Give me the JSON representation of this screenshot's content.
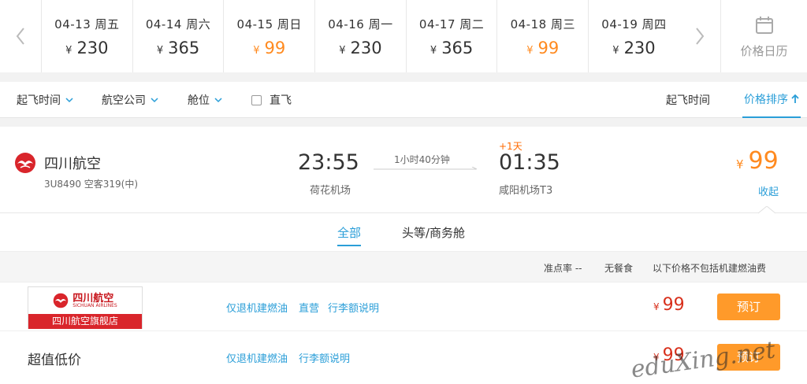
{
  "date_strip": {
    "dates": [
      {
        "date": "04-13 周五",
        "price": "230",
        "low": false
      },
      {
        "date": "04-14 周六",
        "price": "365",
        "low": false
      },
      {
        "date": "04-15 周日",
        "price": "99",
        "low": true
      },
      {
        "date": "04-16 周一",
        "price": "230",
        "low": false
      },
      {
        "date": "04-17 周二",
        "price": "365",
        "low": false
      },
      {
        "date": "04-18 周三",
        "price": "99",
        "low": true
      },
      {
        "date": "04-19 周四",
        "price": "230",
        "low": false
      }
    ],
    "currency": "¥",
    "calendar_label": "价格日历"
  },
  "filters": {
    "departure_time": "起飞时间",
    "airline": "航空公司",
    "cabin": "舱位",
    "direct": "直飞",
    "sort_departure": "起飞时间",
    "sort_price": "价格排序"
  },
  "flight": {
    "airline": "四川航空",
    "flight_no": "3U8490 空客319(中)",
    "dep_time": "23:55",
    "dep_airport": "荷花机场",
    "duration": "1小时40分钟",
    "plus_day": "+1天",
    "arr_time": "01:35",
    "arr_airport": "咸阳机场T3",
    "price": "99",
    "collapse": "收起"
  },
  "cabin_tabs": {
    "all": "全部",
    "first_business": "头等/商务舱"
  },
  "info_bar": {
    "punctuality": "准点率 --",
    "meal": "无餐食",
    "fee_note": "以下价格不包括机建燃油费"
  },
  "offers": [
    {
      "shop_logo_text": "四川航空",
      "shop_sub": "SICHUAN AIRLINES",
      "shop_name": "四川航空旗舰店",
      "links": [
        "仅退机建燃油",
        "直营",
        "行李额说明"
      ],
      "price": "99",
      "book": "预订"
    },
    {
      "label": "超值低价",
      "links": [
        "仅退机建燃油",
        "行李额说明"
      ],
      "price": "99",
      "book": "预订"
    }
  ],
  "watermark": "eduXing.net",
  "colors": {
    "accent_blue": "#2a9ed8",
    "low_price": "#ff8a1f",
    "offer_price": "#d8301c",
    "book_button": "#ff9a2a",
    "brand_red": "#d9252b"
  }
}
